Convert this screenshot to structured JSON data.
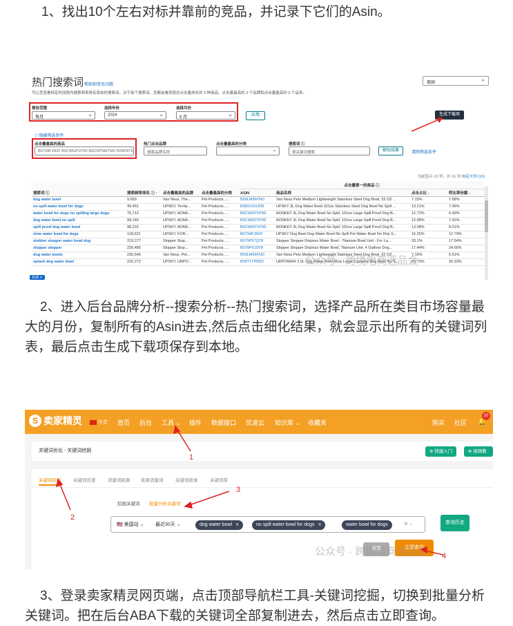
{
  "step1": "1、找出10个左右对标并靠前的竞品，并记录下它们的Asin。",
  "step2": "2、进入后台品牌分析--搜索分析--热门搜索词，选择产品所在类目市场容量最大的月份，复制所有的Asin进去,然后点击细化结果，就会显示出所有的关键词列表，最后点击生成下载项保存到本地。",
  "step3": "3、登录卖家精灵网页端，点击顶部导航栏工具-关键词挖掘，切换到批量分析关键词。把在后台ABA下载的关键词全部复制进去，然后点击立即查询。",
  "aba": {
    "title": "热门搜索词",
    "help_link": "帮助和常见问题",
    "desc": "可让您查看特定时间段内搜索频率排名靠前的搜索词。对于每个搜索词，您都会看到按总点击量排名的 3 种商品、点击量最高的 3 个品牌和点击量最高的 3 个品类。",
    "region": "美国",
    "period_label": "报告范围",
    "period_value": "每月",
    "year_label": "选择年份",
    "year_value": "2024",
    "month_label": "选择月份",
    "month_value": "8 月",
    "apply": "应用",
    "generate": "生成下载项",
    "filter_toggle": "隐藏筛选条件",
    "asin_label": "点击量最高的商品",
    "asin_value": "B0734PJN2F B0CWGP1P9D B0CDPNWTMV B09PR75",
    "brand_label": "热门点击品牌",
    "brand_ph": "搜索品牌名称",
    "cat_label": "点击量最高的分类",
    "term_label": "搜索词 ⓘ",
    "term_ph": "按关键词搜索",
    "refine": "细化结果",
    "clear": "清除筛选条件",
    "meta": "当前显示 15 列，共 16 列",
    "meta_link": "自定义列 (16)",
    "group_header": "点击量第一的商品 ⓘ",
    "headers": [
      "搜索词 ⓘ",
      "搜索频率排名 ⓘ ↑",
      "点击量最高的品牌",
      "点击量最高的分类",
      "ASIN",
      "商品名称",
      "点击占比 ↓",
      "转化率份额 ↓"
    ],
    "rows": [
      [
        "dog water bowl",
        "9,659",
        "Van Ness, The...",
        "Pet Products, ...",
        "B00LM96FNO",
        "Van Ness Pets Medium Lightweight Stainless Steel Dog Bowl, 52 OZ ...",
        "7.15%",
        "7.68%"
      ],
      [
        "no spill water bowl for dogs",
        "49,451",
        "UPSKY, Techp...",
        "Pet Products, ...",
        "B08XVZHJD8",
        "UPSKY 3L Dog Water Bowl 101oz Stainless Steel Dog Bowl No Spill ...",
        "13.21%",
        "7.46%"
      ],
      [
        "water bowl for dogs no spilling large dogs",
        "75,713",
        "UPSKY, AONK...",
        "Pet Products, ...",
        "B0CWGP1P9D",
        "AONKEY 3L Dog Water Bowl No Spill, 101oz Large Spill Proof Dog B...",
        "12.72%",
        "6.49%"
      ],
      [
        "dog water bowl no spill",
        "99,149",
        "UPSKY, AONK...",
        "Pet Products, ...",
        "B0CWGP1P9D",
        "AONKEY 3L Dog Water Bowl No Spill, 101oz Large Spill Proof Dog B...",
        "12.98%",
        "7.42%"
      ],
      [
        "spill proof dog water bowl",
        "98,215",
        "UPSKY, AONK...",
        "Pet Products, ...",
        "B0CWGP1P9D",
        "AONKEY 3L Dog Water Bowl No Spill, 101oz Large Spill Proof Dog B...",
        "13.08%",
        "8.01%"
      ],
      [
        "slow water bowl for dogs",
        "118,022",
        "UPSKY, FOR...",
        "Pet Products, ...",
        "B0734PJN2F",
        "UPSKY Dog Bowl Dog Water Bowl No Spill Pet Water Bowl No Drip S...",
        "16.25%",
        "12.79%"
      ],
      [
        "slobber stopper water bowl dog",
        "219,277",
        "Slopper Stop...",
        "Pet Products, ...",
        "B079P57QT8",
        "Slopper Stopper Dripless Water Bowl - Titanium Bowl Unit - For La...",
        "33.1%",
        "17.54%"
      ],
      [
        "slopper stopper",
        "226,485",
        "Slopper Stop...",
        "Pet Products, ...",
        "B079P51SY8",
        "Slopper Stopper Dripless Water Bowl, Titanium Unit, 4 Gallons Dog...",
        "17.44%",
        "24.66%"
      ],
      [
        "dog water bowls",
        "230,546",
        "Van Ness, Pet...",
        "Pet Products, ...",
        "B00LM96FNO",
        "Van Ness Pets Medium Lightweight Stainless Steel Dog Bowl, 52 OZ ...",
        "7.19%",
        "5.51%"
      ],
      [
        "splash dog water bowl",
        "232,272",
        "UPSKY, URPO...",
        "Pet Products, ...",
        "B08T1TP5KD",
        "URPOWER 2.5L Dog Water Bowl 85oz Large Capacity Dog Bowl No S...",
        "23.75%",
        "20.33%"
      ]
    ],
    "tag": "反馈"
  },
  "sj": {
    "logo": "卖家精灵",
    "flag_text": "中文",
    "nav": [
      "首页",
      "后台",
      "工具",
      "插件",
      "数据接口",
      "优凌云",
      "知识库",
      "收藏夹"
    ],
    "nav_right": [
      "购买",
      "社区"
    ],
    "badge": "10",
    "breadcrumb": "关键词优化 - 关键词挖掘",
    "quick_entry": "快捷入门",
    "video_tutorial": "视频教程",
    "tabs": [
      "关键词挖掘",
      "关键词反查",
      "流量词拓展",
      "拓展流量词",
      "关键词收录",
      "关键词库"
    ],
    "subtabs": [
      "挖掘关键词",
      "批量分析关键词"
    ],
    "country": "美国站",
    "date": "最近30天",
    "chips": [
      "dog water bowl",
      "no spill water bowl for dogs",
      "water bowl for dogs"
    ],
    "history": "查询历史",
    "reset": "重置",
    "query": "立即查询",
    "anno": [
      "1",
      "2",
      "3",
      "4"
    ]
  },
  "watermark": "公众号 · 跨境电商选品会",
  "colors": {
    "accent_orange": "#f08a00",
    "annotation_red": "#dd2222",
    "green": "#11a882",
    "link_blue": "#1a73c8"
  }
}
